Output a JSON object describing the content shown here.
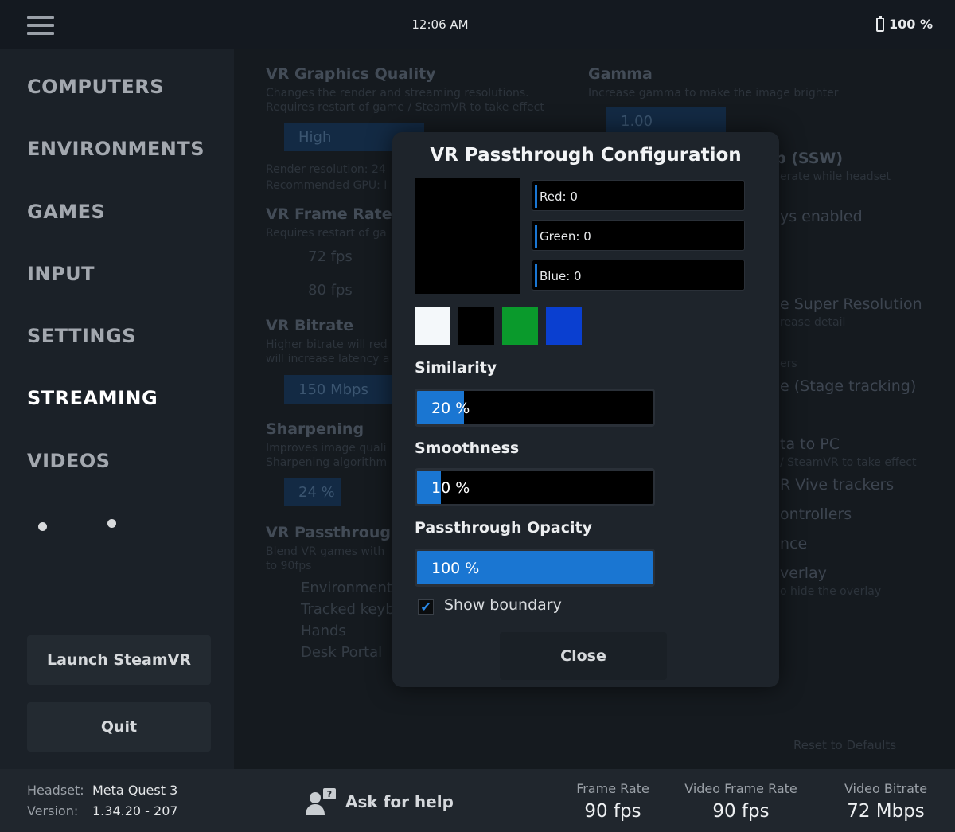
{
  "topbar": {
    "time": "12:06 AM",
    "battery": "100 %"
  },
  "sidebar": {
    "items": [
      {
        "label": "COMPUTERS",
        "active": false
      },
      {
        "label": "ENVIRONMENTS",
        "active": false
      },
      {
        "label": "GAMES",
        "active": false
      },
      {
        "label": "INPUT",
        "active": false
      },
      {
        "label": "SETTINGS",
        "active": false
      },
      {
        "label": "STREAMING",
        "active": true
      },
      {
        "label": "VIDEOS",
        "active": false
      }
    ],
    "launch_label": "Launch SteamVR",
    "quit_label": "Quit"
  },
  "main": {
    "graphics": {
      "title": "VR Graphics Quality",
      "desc1": "Changes the render and streaming resolutions.",
      "desc2": "Requires restart of game / SteamVR to take effect",
      "value": "High",
      "info1": "Render resolution: 24",
      "info2": "Recommended GPU: I"
    },
    "gamma": {
      "title": "Gamma",
      "desc": "Increase gamma to make the image brighter",
      "value": "1.00"
    },
    "frame_rate": {
      "title": "VR Frame Rate",
      "desc": "Requires restart of ga",
      "opt1": "72 fps",
      "opt2": "80 fps"
    },
    "bitrate": {
      "title": "VR Bitrate",
      "desc1": "Higher bitrate will red",
      "desc2": "will increase latency a",
      "value": "150 Mbps"
    },
    "sharpening": {
      "title": "Sharpening",
      "desc1": "Improves image quali",
      "desc2": "Sharpening algorithm",
      "value": "24 %"
    },
    "passthrough": {
      "title": "VR Passthrough",
      "desc1": "Blend VR games with",
      "desc2": "to 90fps",
      "opt1": "Environment",
      "opt2": "Tracked keyb",
      "opt3": "Hands",
      "opt4": "Desk Portal"
    },
    "right": {
      "ssw_title": "p (SSW)",
      "ssw_desc": "erate while headset",
      "always": "ys enabled",
      "super_res": "e Super Resolution",
      "super_desc": "rease detail",
      "ers": "ers",
      "stage": "e (Stage tracking)",
      "data_pc": "ta to PC",
      "data_desc": "/ SteamVR to take effect",
      "vive": "R Vive trackers",
      "controllers": "ontrollers",
      "nce": "nce",
      "overlay": "verlay",
      "overlay_desc": "o hide the overlay",
      "reset": "Reset to Defaults"
    }
  },
  "modal": {
    "title": "VR Passthrough Configuration",
    "red": "Red: 0",
    "green": "Green: 0",
    "blue": "Blue: 0",
    "swatches": [
      "#f4f8fa",
      "#000000",
      "#0a9a2c",
      "#0a3fd0"
    ],
    "similarity_label": "Similarity",
    "similarity_value": "20 %",
    "similarity": 0.2,
    "smoothness_label": "Smoothness",
    "smoothness_value": "10 %",
    "smoothness": 0.1,
    "opacity_label": "Passthrough Opacity",
    "opacity_value": "100 %",
    "opacity": 1.0,
    "show_boundary": "Show boundary",
    "close": "Close"
  },
  "bottom": {
    "headset_label": "Headset:",
    "headset": "Meta Quest 3",
    "version_label": "Version:",
    "version": "1.34.20 - 207",
    "help": "Ask for help",
    "frame_rate_label": "Frame Rate",
    "frame_rate": "90 fps",
    "video_frame_rate_label": "Video Frame Rate",
    "video_frame_rate": "90 fps",
    "video_bitrate_label": "Video Bitrate",
    "video_bitrate": "72 Mbps"
  }
}
